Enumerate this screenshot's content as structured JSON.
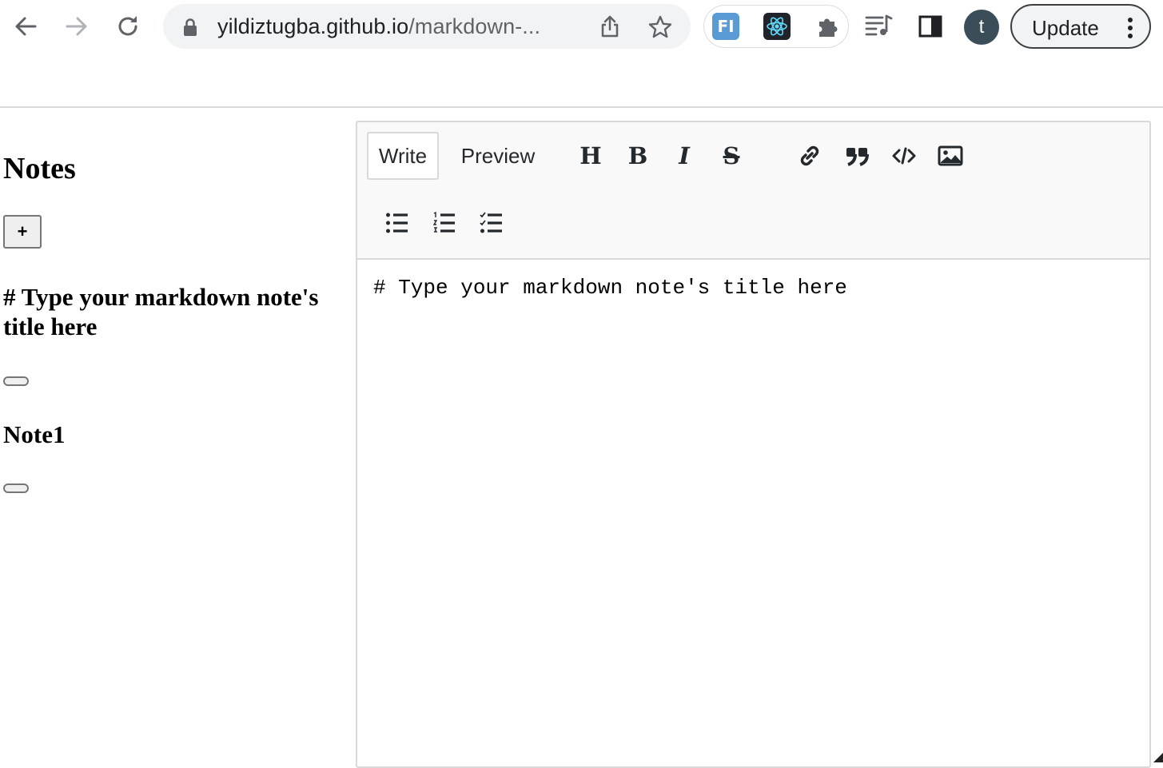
{
  "browser": {
    "url_host": "yildiztugba.github.io",
    "url_path": "/markdown-...",
    "avatar_initial": "t",
    "update_label": "Update",
    "extensions": {
      "fi_label": "FI"
    }
  },
  "sidebar": {
    "heading": "Notes",
    "add_label": "+",
    "notes": [
      {
        "title": "# Type your markdown note's title here"
      },
      {
        "title": "Note1"
      }
    ]
  },
  "editor": {
    "tabs": {
      "write": "Write",
      "preview": "Preview"
    },
    "tools": {
      "heading": "H",
      "bold": "B",
      "italic": "I",
      "strike": "S"
    },
    "content": "# Type your markdown note's title here"
  }
}
